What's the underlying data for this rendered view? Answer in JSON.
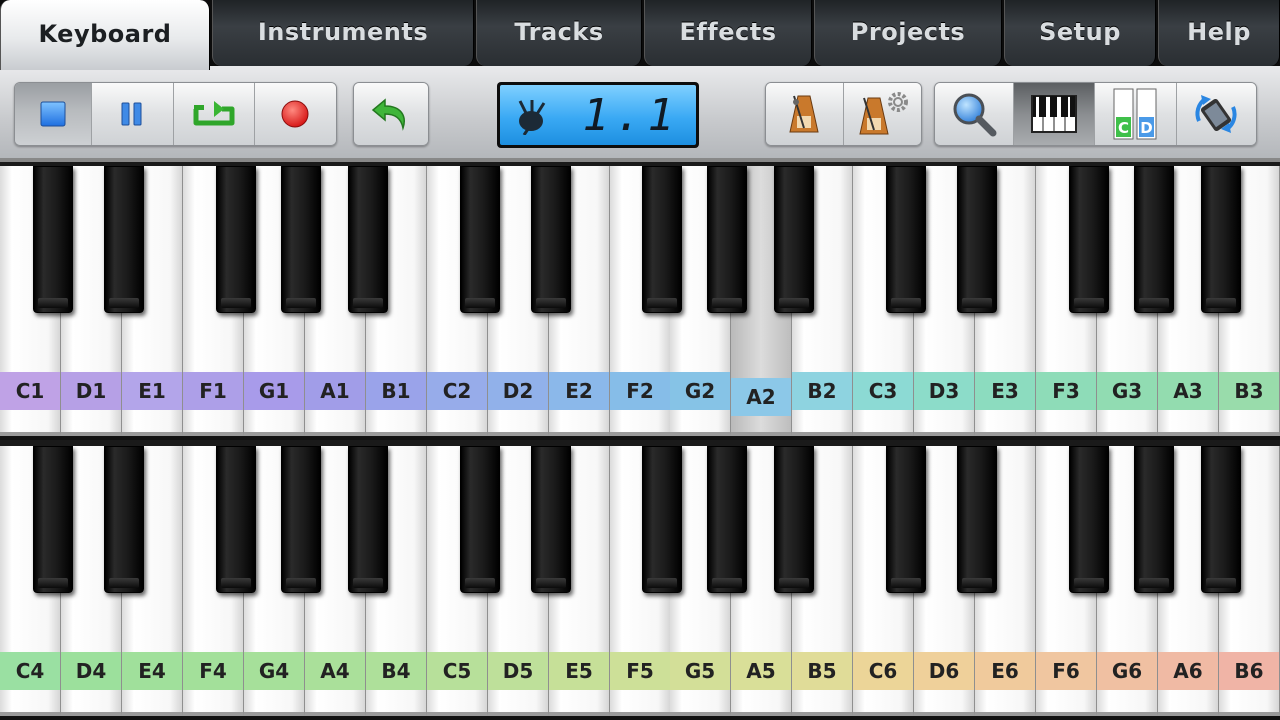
{
  "tabs": [
    {
      "label": "Keyboard",
      "active": true
    },
    {
      "label": "Instruments"
    },
    {
      "label": "Tracks"
    },
    {
      "label": "Effects"
    },
    {
      "label": "Projects"
    },
    {
      "label": "Setup"
    },
    {
      "label": "Help"
    }
  ],
  "transport": {
    "buttons": [
      "stop-icon",
      "pause-icon",
      "loop-icon",
      "record-icon"
    ],
    "undo": "undo-icon"
  },
  "display": {
    "position": "1.1",
    "instrument_icon": "bagpipes-icon"
  },
  "right_tools": {
    "metronome": "metronome-icon",
    "metronome_settings": "metronome-settings-icon",
    "search": "magnifier-icon",
    "keyboard_view": "piano-keys-icon",
    "note_labels": "note-labels-icon",
    "note_labels_letters": [
      "C",
      "D"
    ],
    "rotate": "rotate-device-icon"
  },
  "keyboards": [
    {
      "name": "upper",
      "pressed": "A2",
      "notes": [
        "C1",
        "D1",
        "E1",
        "F1",
        "G1",
        "A1",
        "B1",
        "C2",
        "D2",
        "E2",
        "F2",
        "G2",
        "A2",
        "B2",
        "C3",
        "D3",
        "E3",
        "F3",
        "G3",
        "A3",
        "B3"
      ],
      "colors": [
        "#bfa2e6",
        "#b6a0e6",
        "#b3a5ea",
        "#ad9fe8",
        "#a89bea",
        "#a19de8",
        "#9aa3ea",
        "#97acea",
        "#91b1ea",
        "#8bb8ea",
        "#86bde8",
        "#86c3e6",
        "#8cc8e8",
        "#8ed3e0",
        "#8cdad4",
        "#8cdcc9",
        "#8cdcbf",
        "#8edcb8",
        "#91dcb2",
        "#93dcaf",
        "#99dcab"
      ]
    },
    {
      "name": "lower",
      "pressed": "",
      "notes": [
        "C4",
        "D4",
        "E4",
        "F4",
        "G4",
        "A4",
        "B4",
        "C5",
        "D5",
        "E5",
        "F5",
        "G5",
        "A5",
        "B5",
        "C6",
        "D6",
        "E6",
        "F6",
        "G6",
        "A6",
        "B6"
      ],
      "colors": [
        "#9ae0a2",
        "#9ce09c",
        "#a0e09b",
        "#a3e09a",
        "#a6e09a",
        "#aae09a",
        "#aee09a",
        "#b7e09a",
        "#bee09a",
        "#c6e098",
        "#cde098",
        "#d3df98",
        "#d9df98",
        "#e0dc98",
        "#ecd598",
        "#efd09a",
        "#f0ca9c",
        "#f0c6a0",
        "#f0c0a2",
        "#f0baa4",
        "#f0b4a6"
      ]
    }
  ]
}
